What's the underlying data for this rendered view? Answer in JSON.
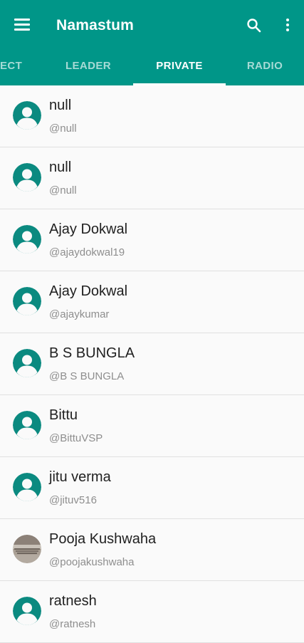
{
  "app": {
    "title": "Namastum",
    "accent_color": "#009688"
  },
  "toolbar": {
    "menu_icon": "hamburger-menu-icon",
    "search_icon": "search-icon",
    "more_icon": "more-vert-icon"
  },
  "tabs": [
    {
      "label": "ECT",
      "active": false
    },
    {
      "label": "LEADER",
      "active": false
    },
    {
      "label": "PRIVATE",
      "active": true
    },
    {
      "label": "RADIO",
      "active": false
    }
  ],
  "contacts": [
    {
      "name": "null",
      "handle": "@null",
      "avatar": "default-avatar-icon"
    },
    {
      "name": "null",
      "handle": "@null",
      "avatar": "default-avatar-icon"
    },
    {
      "name": "Ajay Dokwal",
      "handle": "@ajaydokwal19",
      "avatar": "default-avatar-icon"
    },
    {
      "name": "Ajay Dokwal",
      "handle": "@ajaykumar",
      "avatar": "default-avatar-icon"
    },
    {
      "name": "B S BUNGLA",
      "handle": "@B S BUNGLA",
      "avatar": "default-avatar-icon"
    },
    {
      "name": "Bittu",
      "handle": "@BittuVSP",
      "avatar": "default-avatar-icon"
    },
    {
      "name": "jitu verma",
      "handle": "@jituv516",
      "avatar": "default-avatar-icon"
    },
    {
      "name": "Pooja Kushwaha",
      "handle": "@poojakushwaha",
      "avatar": "photo-avatar"
    },
    {
      "name": "ratnesh",
      "handle": "@ratnesh",
      "avatar": "default-avatar-icon"
    }
  ]
}
